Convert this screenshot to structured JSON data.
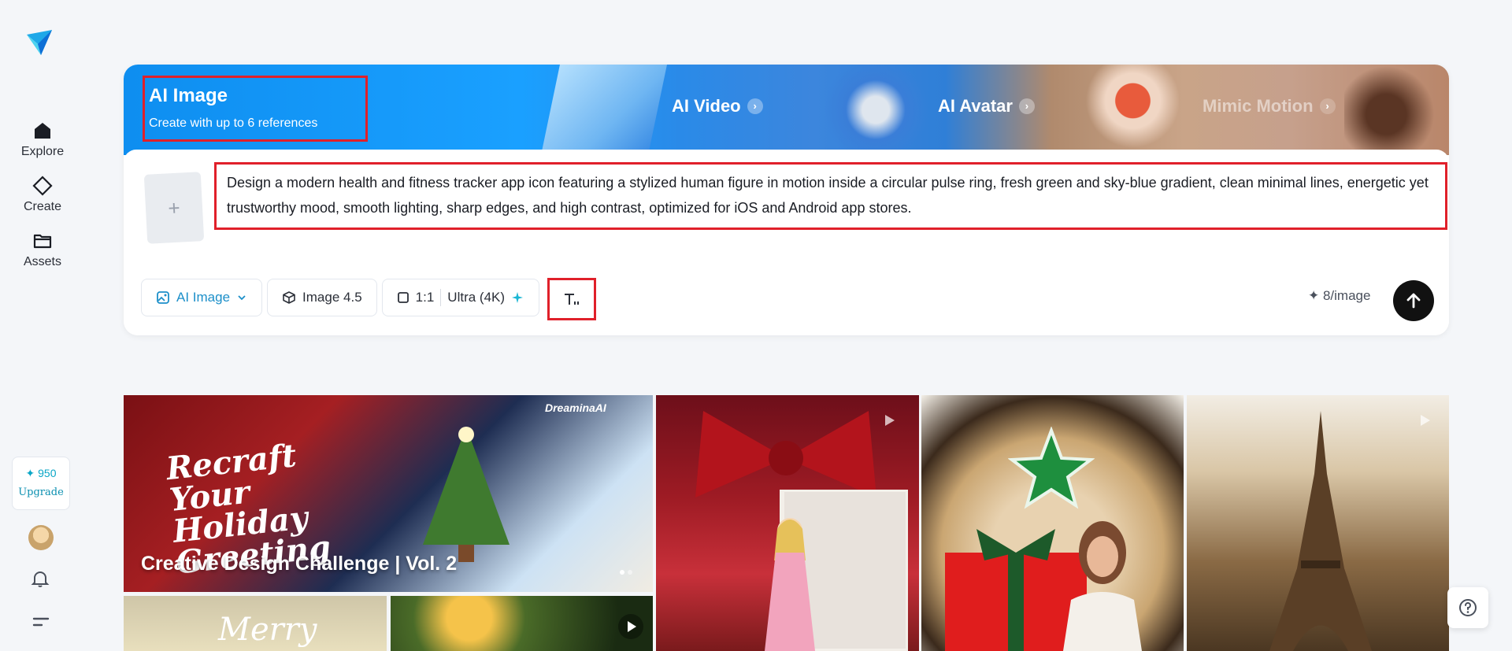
{
  "sidebar": {
    "items": [
      {
        "label": "Explore"
      },
      {
        "label": "Create"
      },
      {
        "label": "Assets"
      }
    ],
    "credits": "950",
    "upgrade": "Upgrade"
  },
  "banner": {
    "title": "AI Image",
    "subtitle": "Create with up to 6 references",
    "links": [
      "AI Video",
      "AI Avatar",
      "Mimic Motion"
    ]
  },
  "composer": {
    "prompt": "Design a modern health and fitness tracker app icon featuring a stylized human figure in motion inside a circular pulse ring, fresh green and sky-blue gradient, clean minimal lines, energetic yet trustworthy mood, smooth lighting, sharp edges, and high contrast, optimized for iOS and Android app stores.",
    "mode": "AI Image",
    "model": "Image 4.5",
    "ratio": "1:1",
    "quality": "Ultra (4K)",
    "cost": "8/image"
  },
  "gallery": {
    "featured_title": "Creative Design Challenge | Vol. 2",
    "featured_art_text": "Recraft Your Holiday Greeting",
    "brand": "DreaminaAI",
    "merry": "Merry"
  },
  "colors": {
    "accent": "#1c8fc9",
    "highlight": "#e0202a"
  }
}
